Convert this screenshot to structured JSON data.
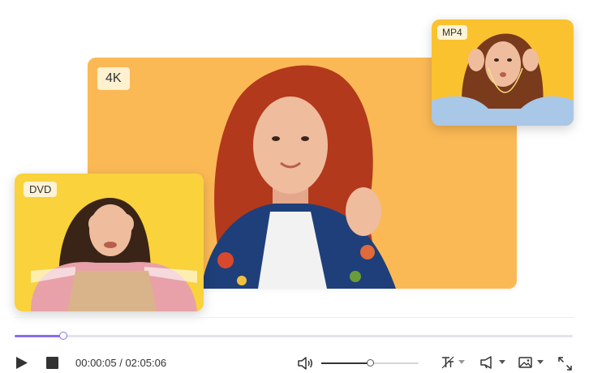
{
  "thumbnails": {
    "main": {
      "format_label": "4K"
    },
    "dvd": {
      "format_label": "DVD"
    },
    "mp4": {
      "format_label": "MP4"
    }
  },
  "player": {
    "current_time": "00:00:05",
    "separator": " / ",
    "total_time": "02:05:06",
    "progress_fraction": 0.087,
    "volume_fraction": 0.5
  },
  "icons": {
    "play": "play-icon",
    "stop": "stop-icon",
    "volume": "volume-icon",
    "subtitle": "subtitle-icon",
    "audio_track": "audio-track-icon",
    "snapshot": "snapshot-icon",
    "fullscreen": "fullscreen-icon"
  },
  "colors": {
    "accent": "#8a6cf0",
    "main_bg": "#fbb955",
    "dvd_bg": "#f9d23c",
    "mp4_bg": "#fbc230"
  }
}
